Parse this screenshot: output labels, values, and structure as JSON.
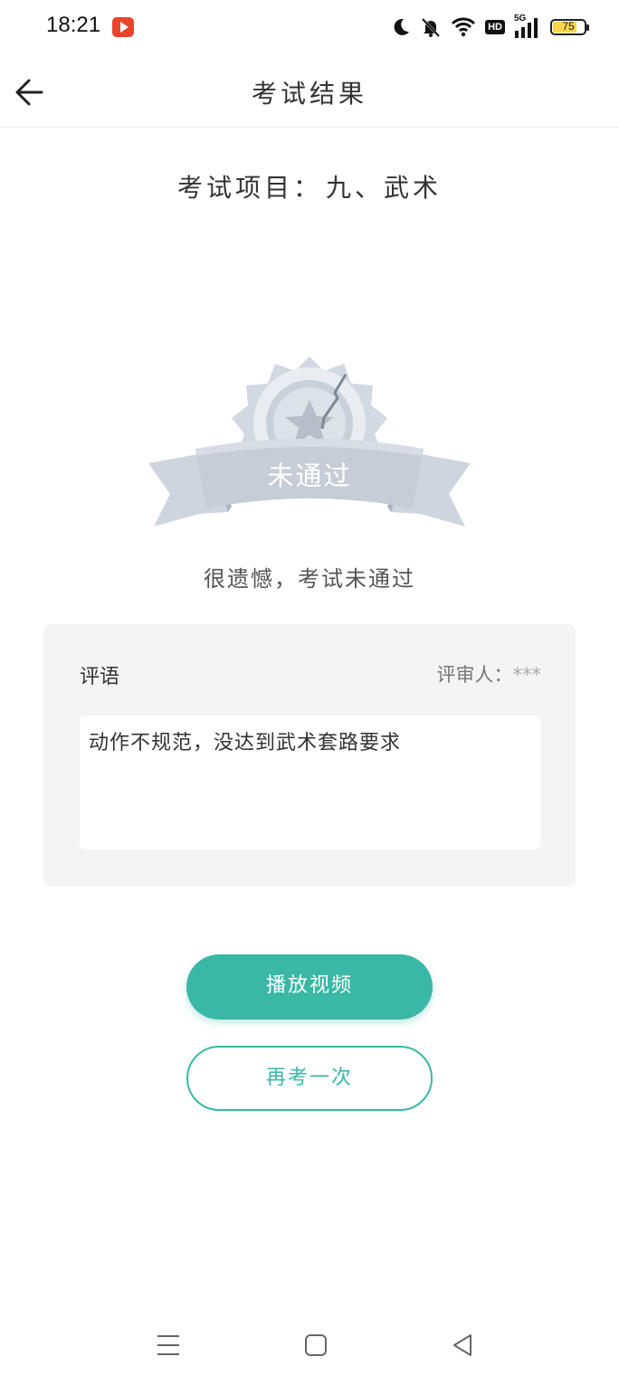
{
  "status_bar": {
    "time": "18:21",
    "battery_level": "75",
    "network": "5G",
    "hd_label": "HD"
  },
  "header": {
    "title": "考试结果"
  },
  "exam": {
    "subject_label": "考试项目：",
    "subject_value": "九、武术"
  },
  "result": {
    "badge_text": "未通过",
    "message": "很遗憾，考试未通过"
  },
  "review": {
    "comment_label": "评语",
    "reviewer_label": "评审人：",
    "reviewer_name": "***",
    "comment_text": "动作不规范，没达到武术套路要求"
  },
  "actions": {
    "play_video": "播放视频",
    "retake": "再考一次"
  },
  "colors": {
    "accent": "#39b8a5",
    "badge_gray": "#c9d0d9"
  }
}
